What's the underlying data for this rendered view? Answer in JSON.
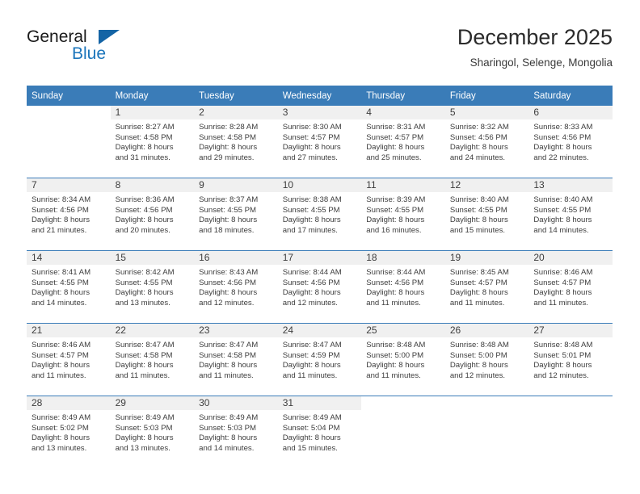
{
  "brand": {
    "name_part1": "General",
    "name_part2": "Blue",
    "triangle_icon": "triangle-logo-icon"
  },
  "header": {
    "title": "December 2025",
    "subtitle": "Sharingol, Selenge, Mongolia"
  },
  "calendar": {
    "weekday_headers": [
      "Sunday",
      "Monday",
      "Tuesday",
      "Wednesday",
      "Thursday",
      "Friday",
      "Saturday"
    ],
    "colors": {
      "header_blue": "#3a7cb8",
      "daynum_band": "#f0f0f0",
      "brand_blue": "#1b75bb",
      "text": "#3d3d3d"
    },
    "weeks": [
      [
        {
          "day": "",
          "sunrise": "",
          "sunset": "",
          "daylight_line1": "",
          "daylight_line2": ""
        },
        {
          "day": "1",
          "sunrise": "Sunrise: 8:27 AM",
          "sunset": "Sunset: 4:58 PM",
          "daylight_line1": "Daylight: 8 hours",
          "daylight_line2": "and 31 minutes."
        },
        {
          "day": "2",
          "sunrise": "Sunrise: 8:28 AM",
          "sunset": "Sunset: 4:58 PM",
          "daylight_line1": "Daylight: 8 hours",
          "daylight_line2": "and 29 minutes."
        },
        {
          "day": "3",
          "sunrise": "Sunrise: 8:30 AM",
          "sunset": "Sunset: 4:57 PM",
          "daylight_line1": "Daylight: 8 hours",
          "daylight_line2": "and 27 minutes."
        },
        {
          "day": "4",
          "sunrise": "Sunrise: 8:31 AM",
          "sunset": "Sunset: 4:57 PM",
          "daylight_line1": "Daylight: 8 hours",
          "daylight_line2": "and 25 minutes."
        },
        {
          "day": "5",
          "sunrise": "Sunrise: 8:32 AM",
          "sunset": "Sunset: 4:56 PM",
          "daylight_line1": "Daylight: 8 hours",
          "daylight_line2": "and 24 minutes."
        },
        {
          "day": "6",
          "sunrise": "Sunrise: 8:33 AM",
          "sunset": "Sunset: 4:56 PM",
          "daylight_line1": "Daylight: 8 hours",
          "daylight_line2": "and 22 minutes."
        }
      ],
      [
        {
          "day": "7",
          "sunrise": "Sunrise: 8:34 AM",
          "sunset": "Sunset: 4:56 PM",
          "daylight_line1": "Daylight: 8 hours",
          "daylight_line2": "and 21 minutes."
        },
        {
          "day": "8",
          "sunrise": "Sunrise: 8:36 AM",
          "sunset": "Sunset: 4:56 PM",
          "daylight_line1": "Daylight: 8 hours",
          "daylight_line2": "and 20 minutes."
        },
        {
          "day": "9",
          "sunrise": "Sunrise: 8:37 AM",
          "sunset": "Sunset: 4:55 PM",
          "daylight_line1": "Daylight: 8 hours",
          "daylight_line2": "and 18 minutes."
        },
        {
          "day": "10",
          "sunrise": "Sunrise: 8:38 AM",
          "sunset": "Sunset: 4:55 PM",
          "daylight_line1": "Daylight: 8 hours",
          "daylight_line2": "and 17 minutes."
        },
        {
          "day": "11",
          "sunrise": "Sunrise: 8:39 AM",
          "sunset": "Sunset: 4:55 PM",
          "daylight_line1": "Daylight: 8 hours",
          "daylight_line2": "and 16 minutes."
        },
        {
          "day": "12",
          "sunrise": "Sunrise: 8:40 AM",
          "sunset": "Sunset: 4:55 PM",
          "daylight_line1": "Daylight: 8 hours",
          "daylight_line2": "and 15 minutes."
        },
        {
          "day": "13",
          "sunrise": "Sunrise: 8:40 AM",
          "sunset": "Sunset: 4:55 PM",
          "daylight_line1": "Daylight: 8 hours",
          "daylight_line2": "and 14 minutes."
        }
      ],
      [
        {
          "day": "14",
          "sunrise": "Sunrise: 8:41 AM",
          "sunset": "Sunset: 4:55 PM",
          "daylight_line1": "Daylight: 8 hours",
          "daylight_line2": "and 14 minutes."
        },
        {
          "day": "15",
          "sunrise": "Sunrise: 8:42 AM",
          "sunset": "Sunset: 4:55 PM",
          "daylight_line1": "Daylight: 8 hours",
          "daylight_line2": "and 13 minutes."
        },
        {
          "day": "16",
          "sunrise": "Sunrise: 8:43 AM",
          "sunset": "Sunset: 4:56 PM",
          "daylight_line1": "Daylight: 8 hours",
          "daylight_line2": "and 12 minutes."
        },
        {
          "day": "17",
          "sunrise": "Sunrise: 8:44 AM",
          "sunset": "Sunset: 4:56 PM",
          "daylight_line1": "Daylight: 8 hours",
          "daylight_line2": "and 12 minutes."
        },
        {
          "day": "18",
          "sunrise": "Sunrise: 8:44 AM",
          "sunset": "Sunset: 4:56 PM",
          "daylight_line1": "Daylight: 8 hours",
          "daylight_line2": "and 11 minutes."
        },
        {
          "day": "19",
          "sunrise": "Sunrise: 8:45 AM",
          "sunset": "Sunset: 4:57 PM",
          "daylight_line1": "Daylight: 8 hours",
          "daylight_line2": "and 11 minutes."
        },
        {
          "day": "20",
          "sunrise": "Sunrise: 8:46 AM",
          "sunset": "Sunset: 4:57 PM",
          "daylight_line1": "Daylight: 8 hours",
          "daylight_line2": "and 11 minutes."
        }
      ],
      [
        {
          "day": "21",
          "sunrise": "Sunrise: 8:46 AM",
          "sunset": "Sunset: 4:57 PM",
          "daylight_line1": "Daylight: 8 hours",
          "daylight_line2": "and 11 minutes."
        },
        {
          "day": "22",
          "sunrise": "Sunrise: 8:47 AM",
          "sunset": "Sunset: 4:58 PM",
          "daylight_line1": "Daylight: 8 hours",
          "daylight_line2": "and 11 minutes."
        },
        {
          "day": "23",
          "sunrise": "Sunrise: 8:47 AM",
          "sunset": "Sunset: 4:58 PM",
          "daylight_line1": "Daylight: 8 hours",
          "daylight_line2": "and 11 minutes."
        },
        {
          "day": "24",
          "sunrise": "Sunrise: 8:47 AM",
          "sunset": "Sunset: 4:59 PM",
          "daylight_line1": "Daylight: 8 hours",
          "daylight_line2": "and 11 minutes."
        },
        {
          "day": "25",
          "sunrise": "Sunrise: 8:48 AM",
          "sunset": "Sunset: 5:00 PM",
          "daylight_line1": "Daylight: 8 hours",
          "daylight_line2": "and 11 minutes."
        },
        {
          "day": "26",
          "sunrise": "Sunrise: 8:48 AM",
          "sunset": "Sunset: 5:00 PM",
          "daylight_line1": "Daylight: 8 hours",
          "daylight_line2": "and 12 minutes."
        },
        {
          "day": "27",
          "sunrise": "Sunrise: 8:48 AM",
          "sunset": "Sunset: 5:01 PM",
          "daylight_line1": "Daylight: 8 hours",
          "daylight_line2": "and 12 minutes."
        }
      ],
      [
        {
          "day": "28",
          "sunrise": "Sunrise: 8:49 AM",
          "sunset": "Sunset: 5:02 PM",
          "daylight_line1": "Daylight: 8 hours",
          "daylight_line2": "and 13 minutes."
        },
        {
          "day": "29",
          "sunrise": "Sunrise: 8:49 AM",
          "sunset": "Sunset: 5:03 PM",
          "daylight_line1": "Daylight: 8 hours",
          "daylight_line2": "and 13 minutes."
        },
        {
          "day": "30",
          "sunrise": "Sunrise: 8:49 AM",
          "sunset": "Sunset: 5:03 PM",
          "daylight_line1": "Daylight: 8 hours",
          "daylight_line2": "and 14 minutes."
        },
        {
          "day": "31",
          "sunrise": "Sunrise: 8:49 AM",
          "sunset": "Sunset: 5:04 PM",
          "daylight_line1": "Daylight: 8 hours",
          "daylight_line2": "and 15 minutes."
        },
        {
          "day": "",
          "sunrise": "",
          "sunset": "",
          "daylight_line1": "",
          "daylight_line2": ""
        },
        {
          "day": "",
          "sunrise": "",
          "sunset": "",
          "daylight_line1": "",
          "daylight_line2": ""
        },
        {
          "day": "",
          "sunrise": "",
          "sunset": "",
          "daylight_line1": "",
          "daylight_line2": ""
        }
      ]
    ]
  }
}
